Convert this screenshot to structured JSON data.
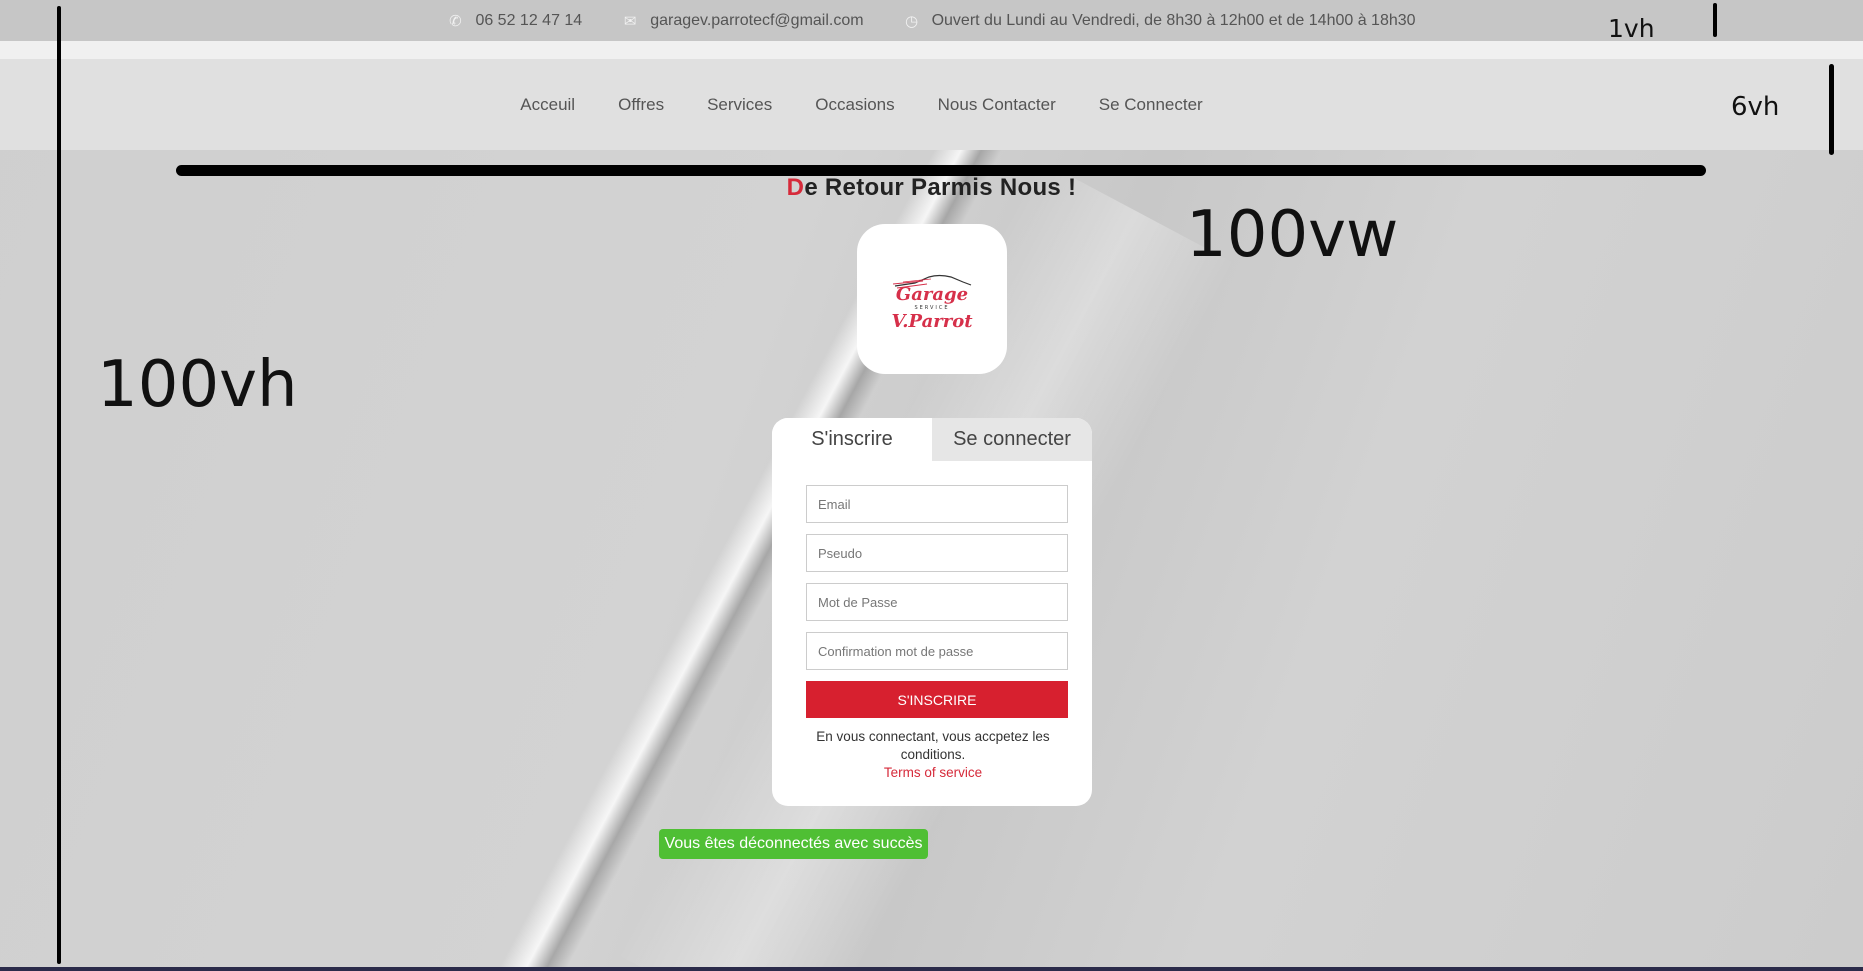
{
  "topbar": {
    "phone": "06 52 12 47 14",
    "email": "garagev.parrotecf@gmail.com",
    "hours": "Ouvert du Lundi au Vendredi, de 8h30 à 12h00 et de 14h00 à 18h30",
    "phone_icon": "phone-icon",
    "email_icon": "mail-icon",
    "clock_icon": "clock-icon"
  },
  "nav": {
    "items": [
      {
        "label": "Acceuil"
      },
      {
        "label": "Offres"
      },
      {
        "label": "Services"
      },
      {
        "label": "Occasions"
      },
      {
        "label": "Nous Contacter"
      },
      {
        "label": "Se Connecter"
      }
    ]
  },
  "annotations": {
    "top_height": "1vh",
    "nav_height": "6vh",
    "width": "100vw",
    "height": "100vh"
  },
  "title": {
    "first_letter": "D",
    "rest": "e Retour Parmis Nous !"
  },
  "logo": {
    "line1": "Garage",
    "line2": "SERVICE",
    "line3": "V.Parrot"
  },
  "form": {
    "tabs": [
      {
        "label": "S'inscrire"
      },
      {
        "label": "Se connecter"
      }
    ],
    "email_placeholder": "Email",
    "pseudo_placeholder": "Pseudo",
    "password_placeholder": "Mot de Passe",
    "confirm_placeholder": "Confirmation mot de passe",
    "submit_label": "S'INSCRIRE",
    "terms_text": "En vous connectant, vous accpetez les conditions.",
    "terms_link": "Terms of service"
  },
  "toast": {
    "message": "Vous êtes déconnectés avec succès"
  },
  "colors": {
    "accent": "#d7202f",
    "success": "#4fbf34"
  }
}
